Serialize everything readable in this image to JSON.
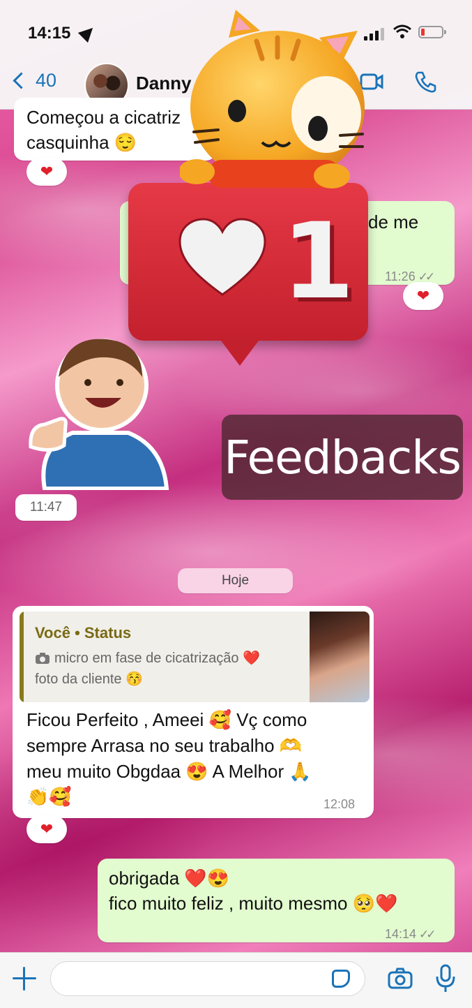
{
  "status_bar": {
    "time": "14:15"
  },
  "header": {
    "back_count": "40",
    "contact_name": "Danny C"
  },
  "messages": {
    "m1_line1": "Começou a cicatriz",
    "m1_line2": "casquinha 😌",
    "m1_reaction": "❤",
    "m2_partial": "A",
    "m2_partial2": "de me",
    "m2_time": "11:26",
    "m2_reaction": "❤",
    "m3_time": "11:47",
    "date_chip": "Hoje",
    "m4_quote_author": "Você • Status",
    "m4_quote_line1": "micro em fase de cicatrização ❤️",
    "m4_quote_line2": "foto da cliente 😚",
    "m4_line1": "Ficou Perfeito , Ameei 🥰 Vç como",
    "m4_line2": "sempre Arrasa no seu trabalho 🫶",
    "m4_line3": "meu muito Obgdaa 😍  A Melhor 🙏",
    "m4_line4": "👏🥰",
    "m4_time": "12:08",
    "m4_reaction": "❤",
    "m5_line1": "obrigada ❤️😍",
    "m5_line2": "fico muito feliz , muito mesmo 🥺❤️",
    "m5_time": "14:14"
  },
  "overlays": {
    "like_count": "1",
    "feedbacks_label": "Feedbacks"
  },
  "colors": {
    "accent": "#1a73b8",
    "outgoing_bubble": "#e2fbcf",
    "incoming_bubble": "#ffffff",
    "like_red": "#e63946"
  }
}
